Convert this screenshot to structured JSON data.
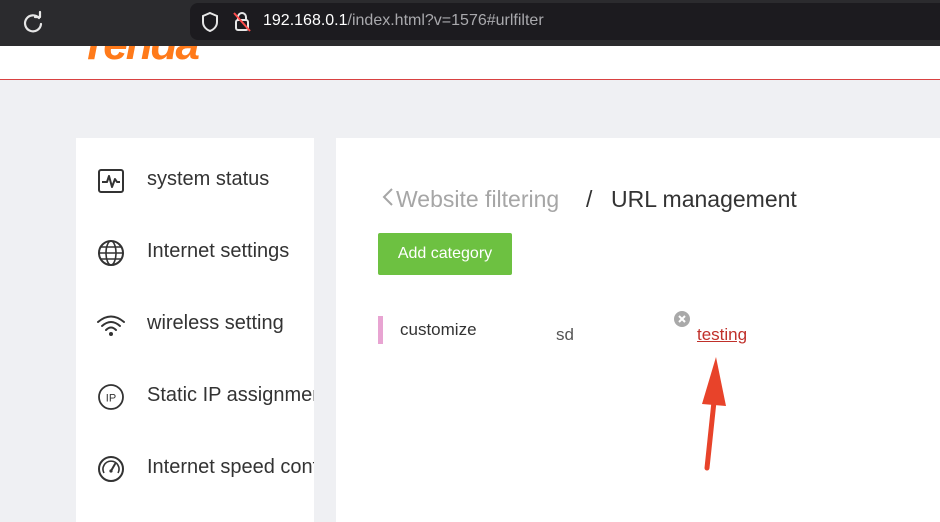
{
  "browser": {
    "url_host": "192.168.0.1",
    "url_path": "/index.html?v=1576#urlfilter"
  },
  "header": {
    "logo_text": "Tenda",
    "logo_color": "#ff7a1a",
    "accent_line": "#d94242"
  },
  "sidebar": {
    "items": [
      {
        "label": "system status",
        "icon": "pulse-monitor-icon"
      },
      {
        "label": "Internet settings",
        "icon": "globe-icon"
      },
      {
        "label": "wireless setting",
        "icon": "wifi-icon"
      },
      {
        "label": "Static IP assignment",
        "icon": "ip-icon"
      },
      {
        "label": "Internet speed control",
        "icon": "speedometer-icon"
      }
    ]
  },
  "main": {
    "breadcrumb_parent": "Website filtering",
    "breadcrumb_separator": "/",
    "breadcrumb_current": "URL management",
    "add_button_label": "Add category",
    "add_button_color": "#6dc141",
    "category": {
      "name": "customize",
      "marker_color": "#e8a4d2",
      "urls": [
        "sd",
        "testing"
      ]
    }
  }
}
